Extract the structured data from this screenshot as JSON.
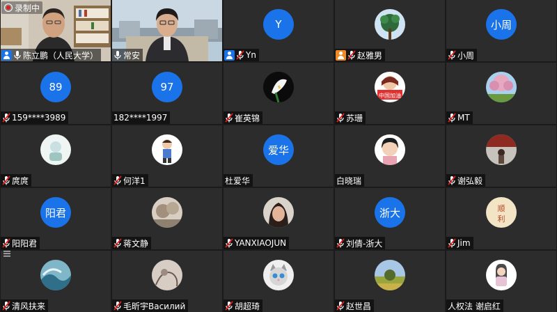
{
  "recording": {
    "label": "录制中"
  },
  "tiles": [
    {
      "name": "陈立鹏（人民大学）",
      "mic": "on",
      "host": true,
      "video": "man1"
    },
    {
      "name": "常安",
      "mic": "on",
      "video": "man2"
    },
    {
      "name": "Yn",
      "mic": "muted",
      "host": true,
      "avatar_text": "Y"
    },
    {
      "name": "赵雅男",
      "mic": "muted",
      "host": true,
      "host_color": "#f08a24",
      "avatar_image": "tree"
    },
    {
      "name": "小周",
      "mic": "muted",
      "avatar_text": "小周"
    },
    {
      "name": "159****3989",
      "mic": "muted",
      "avatar_text": "89"
    },
    {
      "name": "182****1997",
      "mic": "none",
      "avatar_text": "97"
    },
    {
      "name": "崔英锦",
      "mic": "muted",
      "avatar_image": "calla-lily"
    },
    {
      "name": "苏珊",
      "mic": "muted",
      "avatar_image": "cartoon-girl",
      "avatar_caption": "中国加油"
    },
    {
      "name": "MT",
      "mic": "muted",
      "avatar_image": "blossom-tree"
    },
    {
      "name": "庹庹",
      "mic": "muted",
      "avatar_image": "illustration"
    },
    {
      "name": "何洋1",
      "mic": "muted",
      "avatar_image": "cartoon-boy"
    },
    {
      "name": "杜爱华",
      "mic": "none",
      "avatar_text": "爱华"
    },
    {
      "name": "白晓瑞",
      "mic": "none",
      "avatar_image": "girl-photo"
    },
    {
      "name": "谢弘毅",
      "mic": "muted",
      "avatar_image": "red-wall"
    },
    {
      "name": "阳阳君",
      "mic": "muted",
      "avatar_text": "阳君"
    },
    {
      "name": "蒋文静",
      "mic": "muted",
      "avatar_image": "landscape"
    },
    {
      "name": "YANXIAOJUN",
      "mic": "muted",
      "avatar_image": "woman-photo"
    },
    {
      "name": "刘倩-浙大",
      "mic": "muted",
      "avatar_text": "浙大"
    },
    {
      "name": "Jim",
      "mic": "muted",
      "avatar_image": "calligraphy",
      "avatar_caption": "顺利"
    },
    {
      "name": "清风扶来",
      "mic": "muted",
      "avatar_image": "wave"
    },
    {
      "name": "毛昕宇Василий",
      "mic": "muted",
      "avatar_image": "sketch"
    },
    {
      "name": "胡超琦",
      "mic": "muted",
      "avatar_image": "cat"
    },
    {
      "name": "赵世昌",
      "mic": "muted",
      "avatar_image": "field"
    },
    {
      "name": "人权法 谢启红",
      "mic": "none",
      "avatar_image": "cartoon-woman"
    }
  ],
  "colors": {
    "avatar_bg": "#1a73e8",
    "tile_bg": "#2c2c2c",
    "muted_icon": "#e02020"
  }
}
